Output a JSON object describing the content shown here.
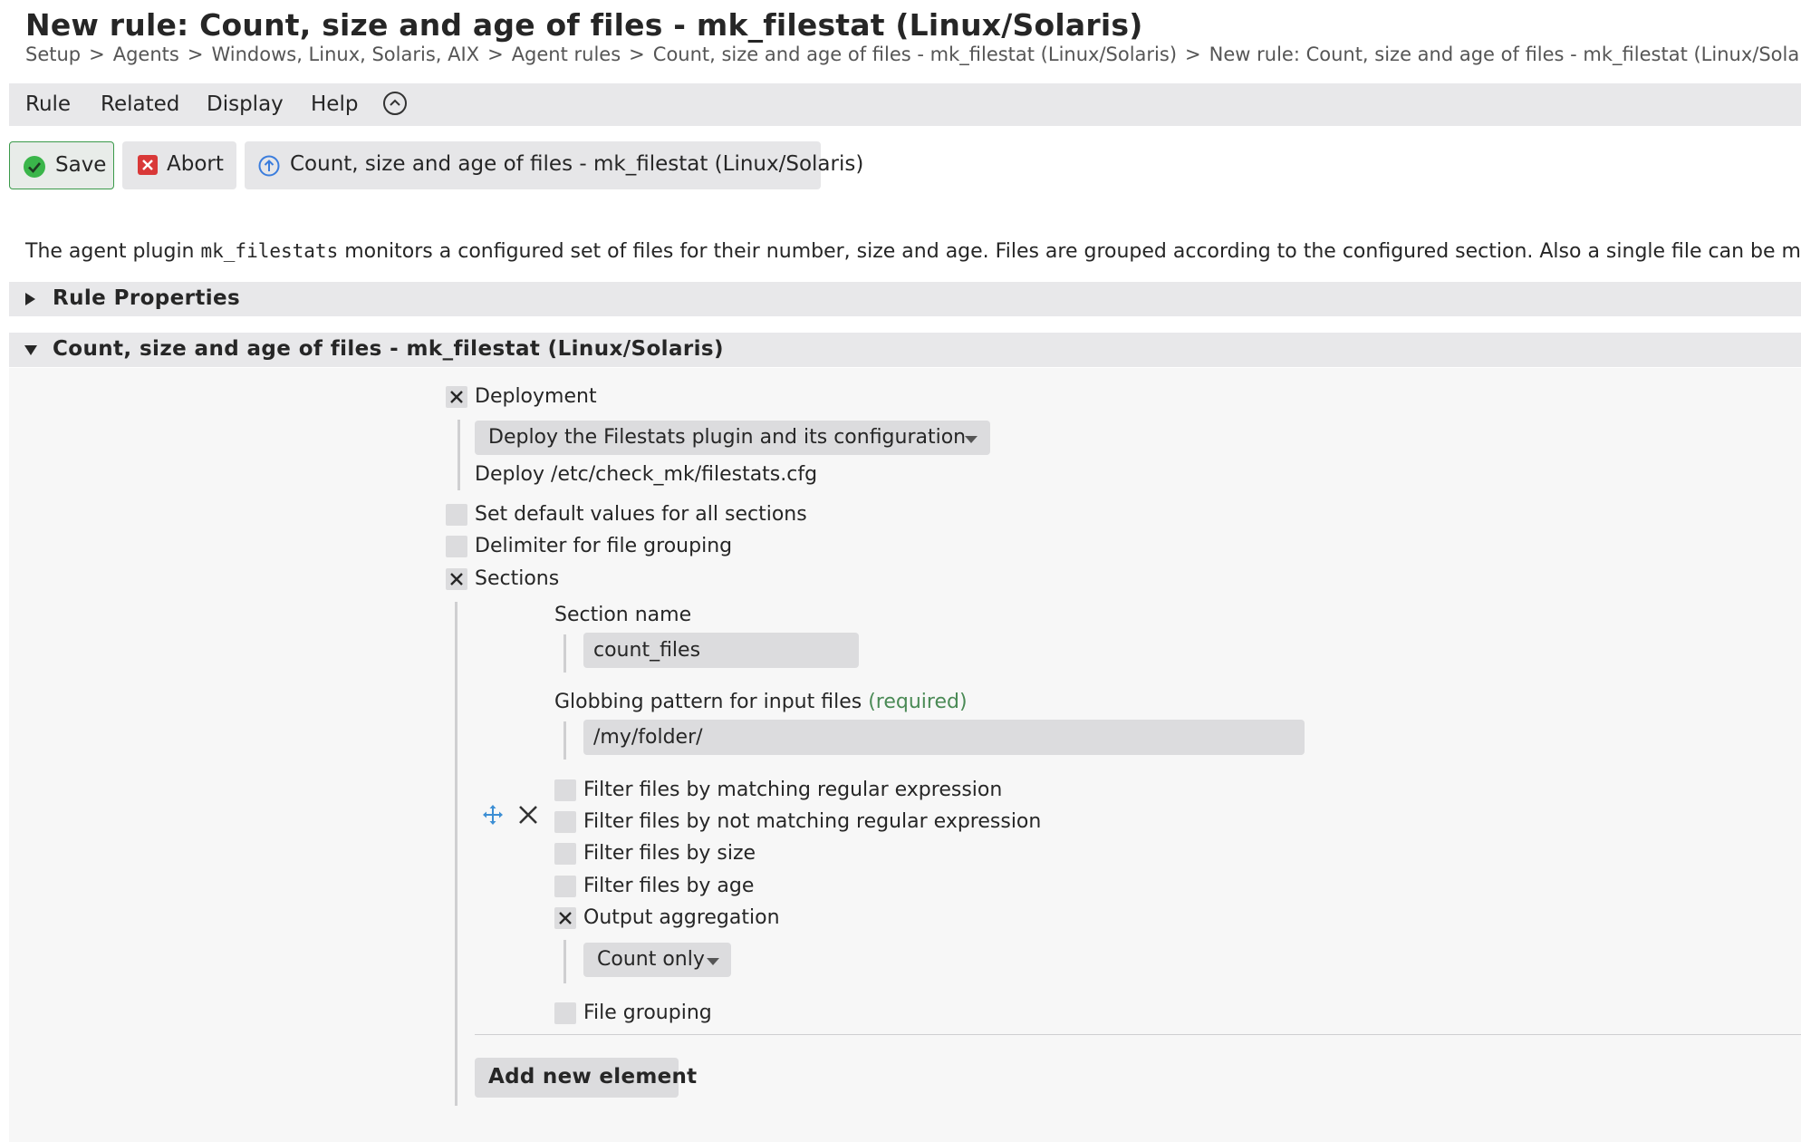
{
  "page": {
    "title": "New rule: Count, size and age of files - mk_filestat (Linux/Solaris)",
    "breadcrumb": [
      "Setup",
      "Agents",
      "Windows, Linux, Solaris, AIX",
      "Agent rules",
      "Count, size and age of files - mk_filestat (Linux/Solaris)",
      "New rule: Count, size and age of files - mk_filestat (Linux/Solaris)"
    ],
    "breadcrumb_separator": ">"
  },
  "menu": {
    "rule": "Rule",
    "related": "Related",
    "display": "Display",
    "help": "Help"
  },
  "toolbar": {
    "save": "Save",
    "abort": "Abort",
    "parent": "Count, size and age of files - mk_filestat (Linux/Solaris)"
  },
  "description": {
    "before": "The agent plugin ",
    "code": "mk_filestats",
    "after": " monitors a configured set of files for their number, size and age. Files are grouped according to the configured section. Also a single file can be monitored."
  },
  "sections": {
    "rule_properties": "Rule Properties",
    "main": "Count, size and age of files - mk_filestat (Linux/Solaris)"
  },
  "form": {
    "deployment": {
      "label": "Deployment",
      "checked": true,
      "select_value": "Deploy the Filestats plugin and its configuration",
      "note": "Deploy /etc/check_mk/filestats.cfg"
    },
    "default_values": {
      "label": "Set default values for all sections",
      "checked": false
    },
    "delimiter": {
      "label": "Delimiter for file grouping",
      "checked": false
    },
    "sections_opt": {
      "label": "Sections",
      "checked": true,
      "element": {
        "section_name_label": "Section name",
        "section_name_value": "count_files",
        "glob_label": "Globbing pattern for input files",
        "glob_required": "(required)",
        "glob_value": "/my/folder/",
        "filter_regex": {
          "label": "Filter files by matching regular expression",
          "checked": false
        },
        "filter_not_regex": {
          "label": "Filter files by not matching regular expression",
          "checked": false
        },
        "filter_size": {
          "label": "Filter files by size",
          "checked": false
        },
        "filter_age": {
          "label": "Filter files by age",
          "checked": false
        },
        "output_aggregation": {
          "label": "Output aggregation",
          "checked": true,
          "select_value": "Count only"
        },
        "file_grouping": {
          "label": "File grouping",
          "checked": false
        }
      },
      "add_button": "Add new element"
    }
  },
  "colors": {
    "menubar_bg": "#e8e8ea",
    "save_border": "#3a9a4a",
    "save_icon": "#3ab54a",
    "abort_icon": "#d93838",
    "parent_icon": "#3b7ddd",
    "required": "#4a8a55",
    "move_icon": "#3d8fd4"
  }
}
